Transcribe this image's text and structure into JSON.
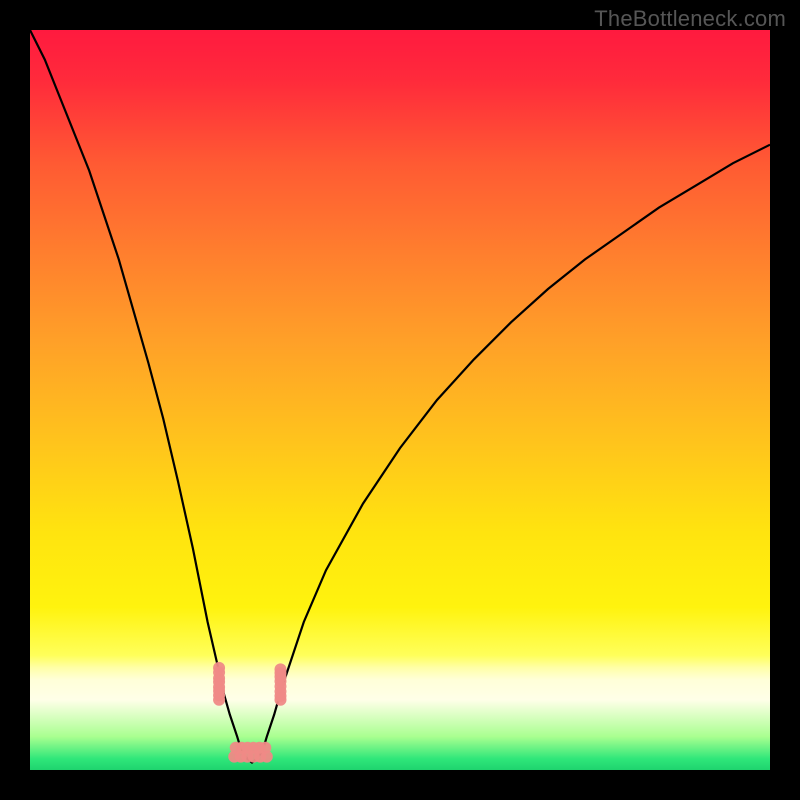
{
  "watermark": {
    "text": "TheBottleneck.com"
  },
  "gradient": {
    "stops": [
      {
        "offset": 0,
        "color": "#ff1a3f"
      },
      {
        "offset": 0.07,
        "color": "#ff2b3b"
      },
      {
        "offset": 0.18,
        "color": "#ff5a33"
      },
      {
        "offset": 0.3,
        "color": "#ff7e2e"
      },
      {
        "offset": 0.42,
        "color": "#ffa028"
      },
      {
        "offset": 0.55,
        "color": "#ffc21d"
      },
      {
        "offset": 0.68,
        "color": "#ffe40f"
      },
      {
        "offset": 0.78,
        "color": "#fff30e"
      },
      {
        "offset": 0.845,
        "color": "#ffff5a"
      },
      {
        "offset": 0.862,
        "color": "#ffffa8"
      },
      {
        "offset": 0.878,
        "color": "#ffffd8"
      },
      {
        "offset": 0.905,
        "color": "#ffffe8"
      },
      {
        "offset": 0.955,
        "color": "#a9ff90"
      },
      {
        "offset": 0.985,
        "color": "#2fe77a"
      },
      {
        "offset": 1.0,
        "color": "#1fd36e"
      }
    ]
  },
  "curve": {
    "stroke": "#000000",
    "stroke_width": 2.2
  },
  "markers": {
    "fill": "#ef8a86",
    "alpha": 0.95,
    "radius_px": 6,
    "groups": [
      {
        "x_pct": 0.2555,
        "y_pct": [
          0.138,
          0.132,
          0.124,
          0.119,
          0.112,
          0.107,
          0.101,
          0.095
        ]
      },
      {
        "x_pct": 0.3385,
        "y_pct": [
          0.095,
          0.1,
          0.106,
          0.113,
          0.12,
          0.126,
          0.131,
          0.136
        ]
      }
    ],
    "bottom_rows": [
      {
        "y_pct": 0.03,
        "x_pct_start": 0.278,
        "x_pct_end": 0.318,
        "count": 6
      },
      {
        "y_pct": 0.018,
        "x_pct_start": 0.276,
        "x_pct_end": 0.32,
        "count": 6
      }
    ]
  },
  "chart_data": {
    "type": "line",
    "title": "",
    "xlabel": "",
    "ylabel": "",
    "xlim": [
      0,
      100
    ],
    "ylim": [
      0,
      100
    ],
    "annotations": [
      "TheBottleneck.com"
    ],
    "series": [
      {
        "name": "bottleneck-curve",
        "x": [
          0,
          2,
          4,
          6,
          8,
          10,
          12,
          14,
          16,
          18,
          20,
          22,
          24,
          25.5,
          26,
          27,
          28,
          28.6,
          29.4,
          30.0,
          30.6,
          31.4,
          32,
          33,
          34,
          35,
          37,
          40,
          45,
          50,
          55,
          60,
          65,
          70,
          75,
          80,
          85,
          90,
          95,
          100
        ],
        "y": [
          100,
          96,
          91,
          86,
          81,
          75,
          69,
          62,
          55,
          47.5,
          39,
          30,
          20,
          13.5,
          11,
          7.5,
          4.5,
          2.5,
          1.5,
          1.0,
          1.5,
          2.5,
          4.5,
          7.5,
          11,
          14,
          20,
          27,
          36,
          43.5,
          50,
          55.5,
          60.5,
          65,
          69,
          72.5,
          76,
          79,
          82,
          84.5
        ]
      }
    ],
    "minimum": {
      "x": 30.0,
      "y": 1.0
    },
    "marker_points": {
      "left_branch": [
        [
          25.5,
          13.8
        ],
        [
          25.5,
          13.2
        ],
        [
          25.5,
          12.4
        ],
        [
          25.5,
          11.9
        ],
        [
          25.5,
          11.2
        ],
        [
          25.5,
          10.7
        ],
        [
          25.5,
          10.1
        ],
        [
          25.5,
          9.5
        ]
      ],
      "right_branch": [
        [
          33.8,
          9.5
        ],
        [
          33.8,
          10.0
        ],
        [
          33.8,
          10.6
        ],
        [
          33.8,
          11.3
        ],
        [
          33.8,
          12.0
        ],
        [
          33.8,
          12.6
        ],
        [
          33.8,
          13.1
        ],
        [
          33.8,
          13.6
        ]
      ],
      "trough": [
        [
          27.8,
          3.0
        ],
        [
          28.6,
          3.0
        ],
        [
          29.4,
          3.0
        ],
        [
          30.2,
          3.0
        ],
        [
          31.0,
          3.0
        ],
        [
          31.8,
          3.0
        ],
        [
          27.6,
          1.8
        ],
        [
          28.5,
          1.8
        ],
        [
          29.4,
          1.8
        ],
        [
          30.3,
          1.8
        ],
        [
          31.2,
          1.8
        ],
        [
          32.0,
          1.8
        ]
      ]
    },
    "background_gradient_meaning": "red=high bottleneck, green=balanced"
  }
}
